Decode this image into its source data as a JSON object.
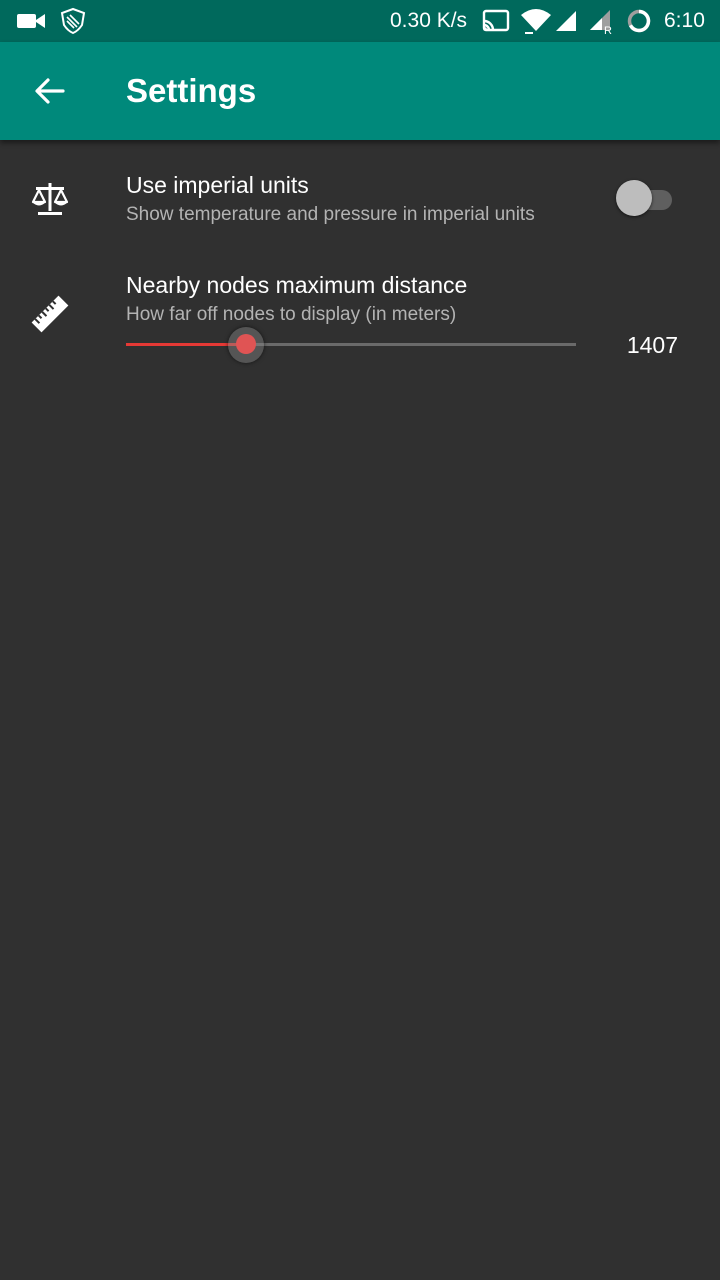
{
  "status_bar": {
    "network_speed": "0.30 K/s",
    "time": "6:10",
    "roaming_indicator": "R",
    "icons": [
      "video-camera-icon",
      "shield-icon",
      "cast-icon",
      "wifi-icon",
      "signal-icon",
      "signal-roaming-icon",
      "battery-ring-icon"
    ]
  },
  "app_bar": {
    "title": "Settings",
    "back_icon": "arrow-back-icon"
  },
  "preferences": [
    {
      "icon": "scale-balance-icon",
      "title": "Use imperial units",
      "summary": "Show temperature and pressure in imperial units",
      "control": "switch",
      "checked": false
    },
    {
      "icon": "ruler-icon",
      "title": "Nearby nodes maximum distance",
      "summary": "How far off nodes to display (in meters)",
      "control": "slider",
      "value": "1407",
      "fraction": 0.267
    }
  ],
  "colors": {
    "status_bar": "#00695c",
    "app_bar": "#00897b",
    "background": "#303030",
    "accent": "#e53935",
    "summary_text": "#b3b3b3"
  }
}
